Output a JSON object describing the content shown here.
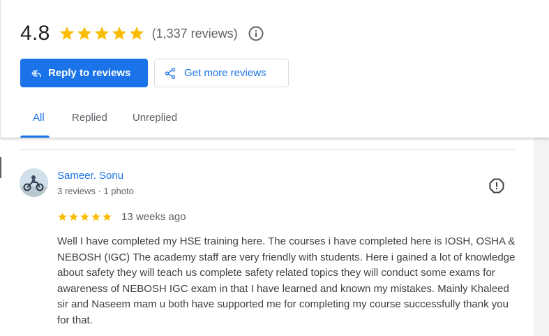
{
  "summary": {
    "rating": "4.8",
    "star_count": 5,
    "review_count": "(1,337 reviews)"
  },
  "actions": {
    "reply_label": "Reply to reviews",
    "get_more_label": "Get more reviews"
  },
  "tabs": [
    {
      "label": "All",
      "active": true
    },
    {
      "label": "Replied",
      "active": false
    },
    {
      "label": "Unreplied",
      "active": false
    }
  ],
  "review": {
    "author": "Sameer. Sonu",
    "meta": "3 reviews · 1 photo",
    "stars": 5,
    "age": "13 weeks ago",
    "text": "Well I have completed my HSE training here. The courses i have completed here is IOSH, OSHA & NEBOSH (IGC) The academy staff are very friendly with students. Here i gained a lot of knowledge about safety they will teach us complete safety related topics they will conduct some exams for awareness of NEBOSH IGC exam in that I have learned and known my mistakes. Mainly Khaleed sir and Naseem mam u both have supported me for completing my course successfully thank you for that."
  },
  "colors": {
    "accent": "#1a73e8",
    "star": "#fbbc04",
    "muted": "#5f6368"
  },
  "icons": {
    "star": "star-icon",
    "info": "info-icon",
    "reply": "reply-icon",
    "share": "share-icon",
    "flag": "flag-icon"
  }
}
